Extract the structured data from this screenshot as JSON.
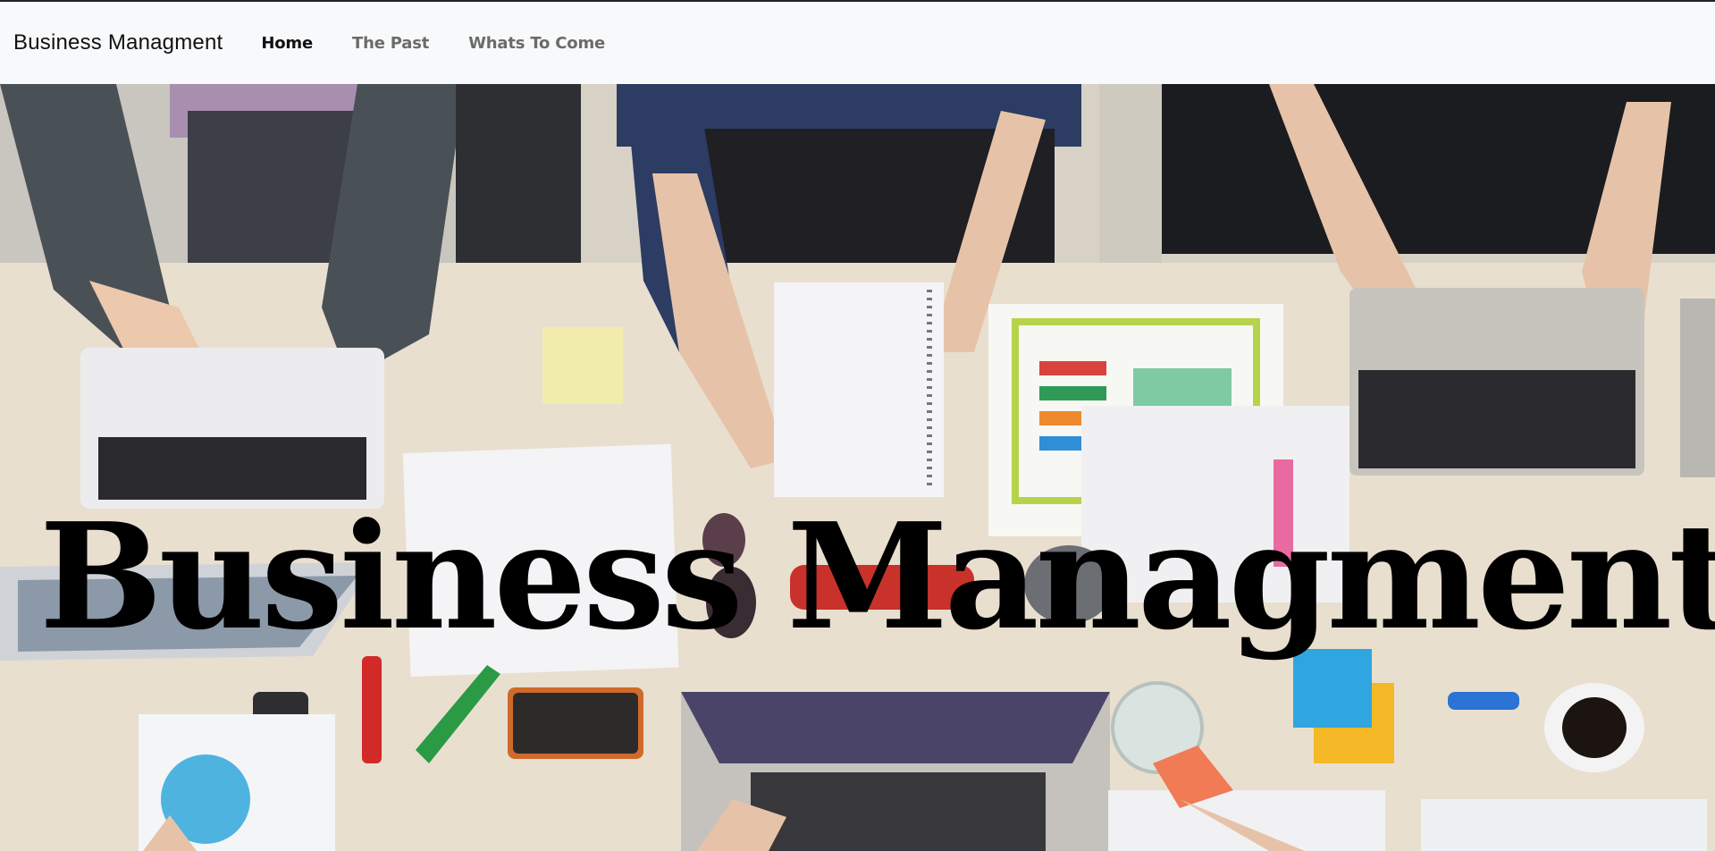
{
  "navbar": {
    "brand": "Business Managment",
    "links": [
      {
        "label": "Home",
        "active": true
      },
      {
        "label": "The Past",
        "active": false
      },
      {
        "label": "Whats To Come",
        "active": false
      }
    ]
  },
  "hero": {
    "title": "Business Managment"
  },
  "colors": {
    "navbar_bg": "#f8f9fb",
    "active_link": "#111111",
    "inactive_link": "#6b6b6b",
    "desk": "#e7dccb"
  }
}
